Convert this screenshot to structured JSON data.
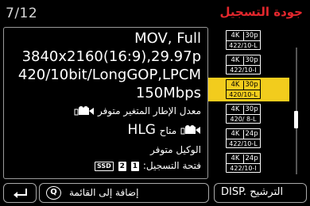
{
  "header": {
    "page_indicator": "7/12",
    "title": "جودة التسجيل"
  },
  "info": {
    "line1": "MOV, Full",
    "line2": "3840x2160(16:9),29.97p",
    "line3": "420/10bit/LongGOP,LPCM",
    "line4": "150Mbps",
    "line5": "معدل الإطار المتغير متوفر",
    "line6_hlg": "HLG",
    "line6_ar": "متاح",
    "line7": "الوكيل متوفر",
    "line8": "فتحة التسجيل:",
    "slots": [
      "1",
      "2",
      "SSD"
    ]
  },
  "formats": [
    {
      "res": "4K",
      "fps": "30p",
      "codec": "422/10-L",
      "selected": false
    },
    {
      "res": "4K",
      "fps": "30p",
      "codec": "422/10-I",
      "selected": false
    },
    {
      "res": "4K",
      "fps": "30p",
      "codec": "420/10-L",
      "selected": true
    },
    {
      "res": "4K",
      "fps": "30p",
      "codec": "420/ 8-L",
      "selected": false
    },
    {
      "res": "4K",
      "fps": "24p",
      "codec": "422/10-L",
      "selected": false
    },
    {
      "res": "4K",
      "fps": "24p",
      "codec": "422/10-I",
      "selected": false
    }
  ],
  "footer": {
    "back_icon": "back-arrow-icon",
    "q_label": "Q",
    "add_label": "إضافة إلى القائمة",
    "filter_label": "DISP. الترشيح"
  },
  "colors": {
    "title_red": "#e4272d",
    "selected_yellow": "#f2cc1d"
  }
}
